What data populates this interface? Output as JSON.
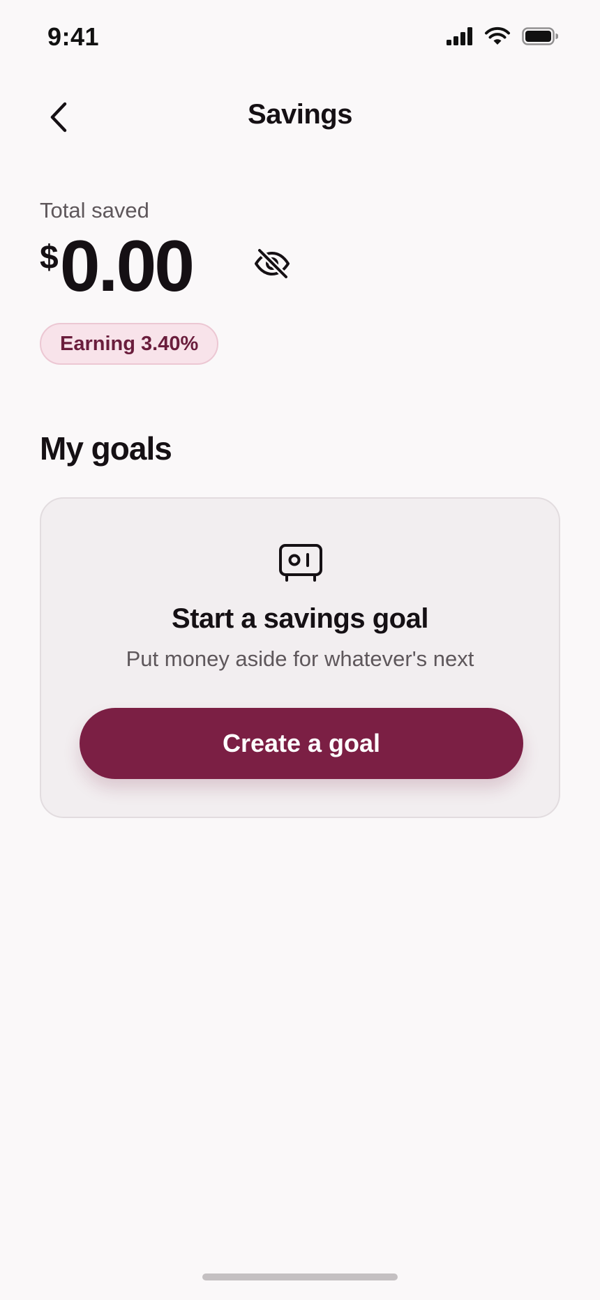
{
  "status_bar": {
    "time": "9:41",
    "icons": [
      "cellular-signal-icon",
      "wifi-icon",
      "battery-icon"
    ]
  },
  "nav": {
    "back_icon": "chevron-left-icon",
    "title": "Savings"
  },
  "summary": {
    "label": "Total saved",
    "currency_symbol": "$",
    "amount": "0.00",
    "visibility_icon": "eye-slash-icon",
    "rate_badge": "Earning 3.40%"
  },
  "goals": {
    "section_title": "My goals",
    "empty_card": {
      "icon": "safe-icon",
      "title": "Start a savings goal",
      "subtitle": "Put money aside for whatever's next",
      "button_label": "Create a goal"
    }
  },
  "colors": {
    "background": "#faf8f9",
    "primary": "#7b1f44",
    "badge_background": "#f8e3ea",
    "badge_text": "#6a1d3c",
    "card_background": "#f2eef0"
  }
}
